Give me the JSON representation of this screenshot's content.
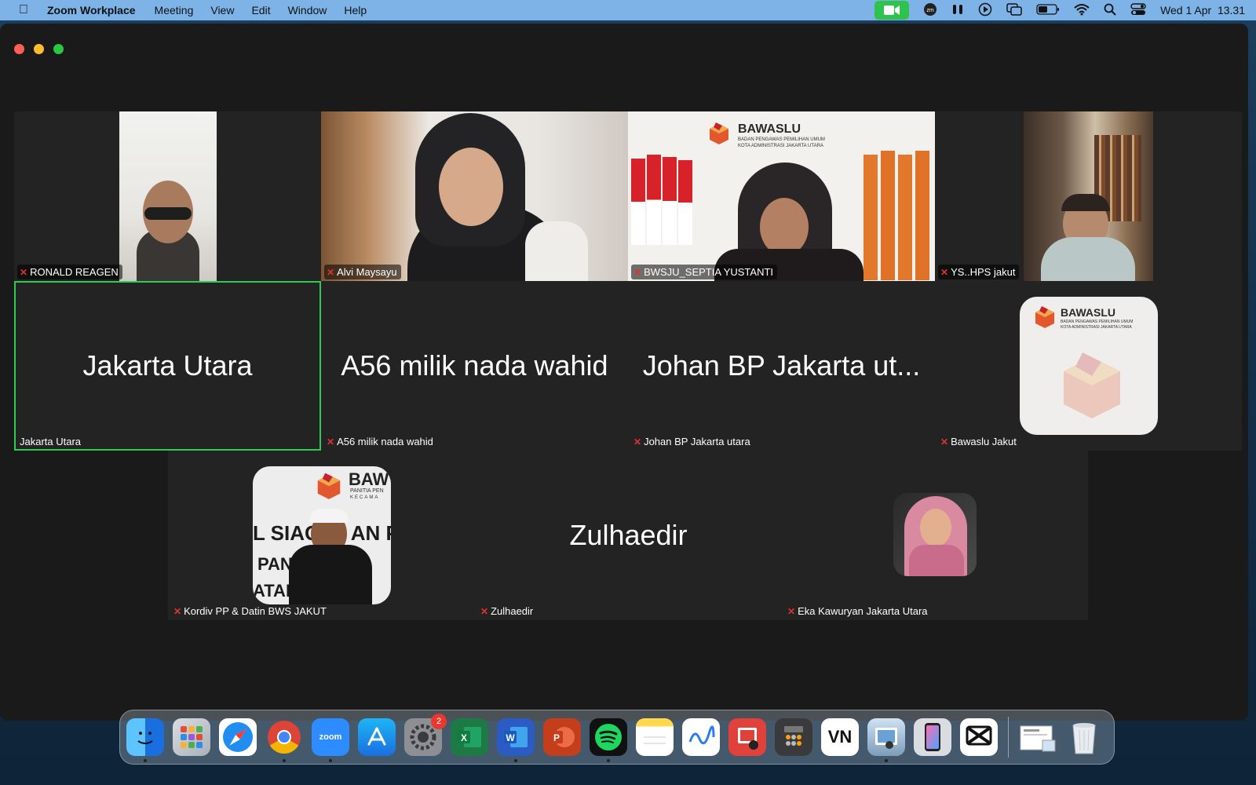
{
  "menubar": {
    "app_name": "Zoom Workplace",
    "menus": [
      "Meeting",
      "View",
      "Edit",
      "Window",
      "Help"
    ],
    "clock": "Wed 1 Apr  13.31"
  },
  "participants": [
    {
      "name": "RONALD REAGEN",
      "muted": true
    },
    {
      "name": "Alvi Maysayu",
      "muted": true
    },
    {
      "name": "BWSJU_SEPTIA YUSTANTI",
      "muted": true
    },
    {
      "name": "YS..HPS jakut",
      "muted": true
    },
    {
      "name": "Jakarta Utara",
      "display": "Jakarta Utara",
      "muted": false,
      "active_speaker": true
    },
    {
      "name": "A56 milik nada wahid",
      "display": "A56 milik nada wahid",
      "muted": true
    },
    {
      "name": "Johan BP Jakarta utara",
      "display": "Johan BP Jakarta ut...",
      "muted": true
    },
    {
      "name": "Bawaslu Jakut",
      "muted": true
    },
    {
      "name": "Kordiv PP & Datin BWS JAKUT",
      "muted": true
    },
    {
      "name": "Zulhaedir",
      "display": "Zulhaedir",
      "muted": true
    },
    {
      "name": "Eka Kawuryan Jakarta Utara",
      "muted": true
    }
  ],
  "bawaslu": {
    "title": "BAWASLU",
    "subtitle1": "BADAN PENGAWAS PEMILIHAN UMUM",
    "subtitle2": "KOTA ADMINISTRASI JAKARTA UTARA"
  },
  "kordiv_photo": {
    "banner_title": "BAW",
    "banner_sub1": "PANITIA PEN",
    "banner_sub2": "KECAMA",
    "line1": "L SIAGA   AN PA",
    "line2": "PANW   RKD",
    "line3": "ATAN"
  },
  "dock": {
    "apps": [
      "Finder",
      "Launchpad",
      "Safari",
      "Chrome",
      "zoom",
      "App Store",
      "System Settings",
      "Excel",
      "Word",
      "PowerPoint",
      "Spotify",
      "Notes",
      "Freeform",
      "Photo Booth",
      "Calculator",
      "VN",
      "Preview",
      "iPhone Mirroring",
      "CapCut",
      "Downloads",
      "Trash"
    ],
    "zoom_label": "zoom",
    "vn_label": "VN",
    "settings_badge": "2"
  },
  "colors": {
    "menubar": "#7db3e6",
    "active_speaker": "#2ecc52",
    "muted_icon": "#e0332f"
  }
}
